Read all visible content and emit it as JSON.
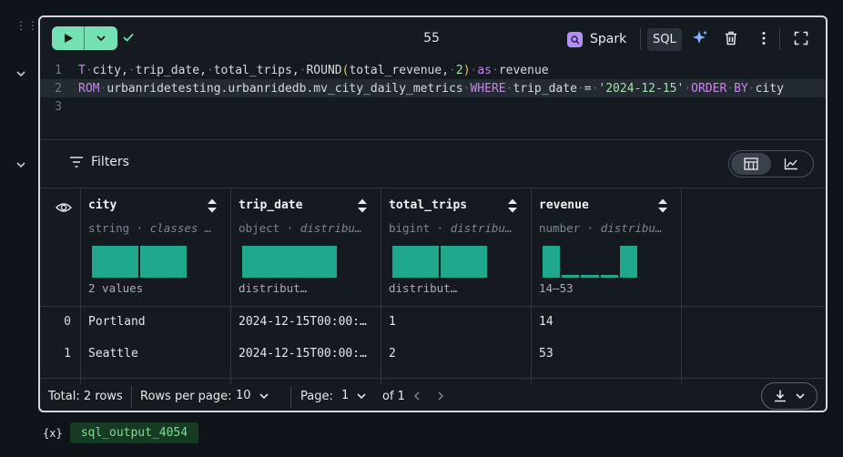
{
  "toolbar": {
    "exec_count": "55",
    "kernel_label": "Spark",
    "language_label": "SQL"
  },
  "editor": {
    "lines": [
      {
        "number": "1",
        "segments": [
          {
            "t": "T",
            "c": "kw"
          },
          {
            "t": "·",
            "c": "ws"
          },
          {
            "t": "city,",
            "c": ""
          },
          {
            "t": "·",
            "c": "ws"
          },
          {
            "t": "trip_date,",
            "c": ""
          },
          {
            "t": "·",
            "c": "ws"
          },
          {
            "t": "total_trips,",
            "c": ""
          },
          {
            "t": "·",
            "c": "ws"
          },
          {
            "t": "ROUND",
            "c": ""
          },
          {
            "t": "(",
            "c": "paren"
          },
          {
            "t": "total_revenue,",
            "c": ""
          },
          {
            "t": "·",
            "c": "ws"
          },
          {
            "t": "2",
            "c": "num"
          },
          {
            "t": ")",
            "c": "paren"
          },
          {
            "t": "·",
            "c": "ws"
          },
          {
            "t": "as",
            "c": "kw"
          },
          {
            "t": "·",
            "c": "ws"
          },
          {
            "t": "revenue",
            "c": ""
          }
        ]
      },
      {
        "number": "2",
        "segments": [
          {
            "t": "ROM",
            "c": "kw"
          },
          {
            "t": "·",
            "c": "ws"
          },
          {
            "t": "urbanridetesting.urbanridedb.mv_city_daily_metrics",
            "c": ""
          },
          {
            "t": "·",
            "c": "ws"
          },
          {
            "t": "WHERE",
            "c": "kw"
          },
          {
            "t": "·",
            "c": "ws"
          },
          {
            "t": "trip_date",
            "c": ""
          },
          {
            "t": "·",
            "c": "ws"
          },
          {
            "t": "=",
            "c": ""
          },
          {
            "t": "·",
            "c": "ws"
          },
          {
            "t": "'2024-12-15'",
            "c": "str"
          },
          {
            "t": "·",
            "c": "ws"
          },
          {
            "t": "ORDER",
            "c": "kw"
          },
          {
            "t": "·",
            "c": "ws"
          },
          {
            "t": "BY",
            "c": "kw"
          },
          {
            "t": "·",
            "c": "ws"
          },
          {
            "t": "city",
            "c": ""
          }
        ]
      },
      {
        "number": "3",
        "segments": []
      }
    ]
  },
  "output": {
    "filters_label": "Filters",
    "columns": [
      {
        "name": "city",
        "type": "string",
        "sub": "classes …",
        "summary": "2 values",
        "hist": [
          1,
          1
        ]
      },
      {
        "name": "trip_date",
        "type": "object",
        "sub": "distribu…",
        "summary": "distribut…",
        "hist": [
          1
        ]
      },
      {
        "name": "total_trips",
        "type": "bigint",
        "sub": "distribu…",
        "summary": "distribut…",
        "hist": [
          1,
          1
        ]
      },
      {
        "name": "revenue",
        "type": "number",
        "sub": "distribu…",
        "summary": "14—53",
        "hist": [
          1,
          0.1,
          0.1,
          0.1,
          1
        ]
      }
    ],
    "rows": [
      {
        "index": "0",
        "city": "Portland",
        "trip_date": "2024-12-15T00:00:…",
        "total_trips": "1",
        "revenue": "14"
      },
      {
        "index": "1",
        "city": "Seattle",
        "trip_date": "2024-12-15T00:00:…",
        "total_trips": "2",
        "revenue": "53"
      }
    ],
    "footer": {
      "total": "Total: 2 rows",
      "rows_per_page_label": "Rows per page:",
      "rows_per_page_value": "10",
      "page_label": "Page:",
      "page_value": "1",
      "page_of": "of 1"
    }
  },
  "variable": {
    "icon": "{x}",
    "name": "sql_output_4054"
  },
  "colors": {
    "accent_run": "#74e0b3",
    "histogram": "#1fa88c",
    "variable_bg": "#173a24",
    "variable_fg": "#7fdc93"
  }
}
